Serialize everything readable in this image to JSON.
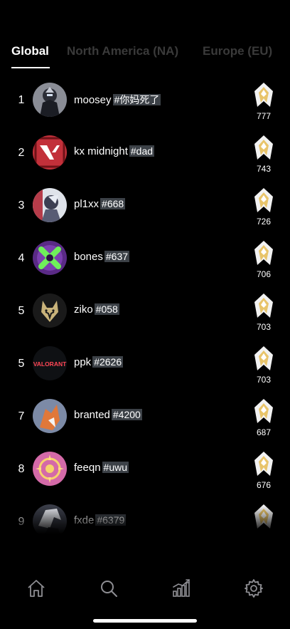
{
  "tabs": [
    {
      "label": "Global",
      "active": true
    },
    {
      "label": "North America (NA)",
      "active": false
    },
    {
      "label": "Europe (EU)",
      "active": false
    }
  ],
  "leaderboard": [
    {
      "rank": "1",
      "username": "moosey",
      "tag": "#你妈死了",
      "rr": "777",
      "avatar": "dark-armored-agent"
    },
    {
      "rank": "2",
      "username": "kx midnight",
      "tag": "#dad",
      "rr": "743",
      "avatar": "red-valorant-logo"
    },
    {
      "rank": "3",
      "username": "pl1xx",
      "tag": "#668",
      "rr": "726",
      "avatar": "agent-portrait"
    },
    {
      "rank": "4",
      "username": "bones",
      "tag": "#637",
      "rr": "706",
      "avatar": "purple-green-x"
    },
    {
      "rank": "5",
      "username": "ziko",
      "tag": "#058",
      "rr": "703",
      "avatar": "wolf-emblem"
    },
    {
      "rank": "5",
      "username": "ppk",
      "tag": "#2626",
      "rr": "703",
      "avatar": "valorant-wordmark"
    },
    {
      "rank": "7",
      "username": "branted",
      "tag": "#4200",
      "rr": "687",
      "avatar": "fox-card"
    },
    {
      "rank": "8",
      "username": "feeqn",
      "tag": "#uwu",
      "rr": "676",
      "avatar": "pink-emblem"
    },
    {
      "rank": "9",
      "username": "fxde",
      "tag": "#6379",
      "rr": "",
      "avatar": "white-hair-agent"
    }
  ],
  "avatar_text": {
    "valorant_wordmark": "VALORANT"
  },
  "nav": [
    "home-icon",
    "search-icon",
    "leaderboard-icon",
    "settings-icon"
  ],
  "colors": {
    "background": "#000000",
    "tag_bg": "#3c4147",
    "inactive_tab": "#3a3a3a",
    "badge_gold": "#e8c46a"
  }
}
